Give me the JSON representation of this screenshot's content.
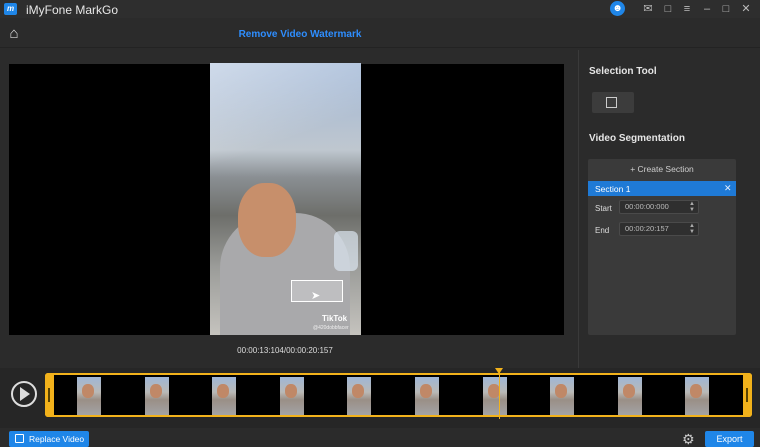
{
  "app": {
    "title": "iMyFone MarkGo",
    "logo_text": "m"
  },
  "window_controls": {
    "avatar_icon": "user-icon",
    "mail_icon": "mail-icon",
    "feedback_icon": "feedback-icon",
    "menu_icon": "menu-icon",
    "minimize_icon": "minimize-icon",
    "maximize_icon": "maximize-icon",
    "close_icon": "close-icon"
  },
  "toolbar": {
    "home_icon": "home-icon",
    "page_title": "Remove Video Watermark"
  },
  "preview": {
    "timecode": "00:00:13:104/00:00:20:157",
    "watermark_brand": "TikTok",
    "watermark_handle": "@420dobbfacer"
  },
  "panel": {
    "selection_tool_heading": "Selection Tool",
    "segmentation_heading": "Video Segmentation",
    "create_section_label": "+ Create Section",
    "section_name": "Section 1",
    "start_label": "Start",
    "start_value": "00:00:00:000",
    "end_label": "End",
    "end_value": "00:00:20:157"
  },
  "timeline": {
    "playhead_fraction": 0.647
  },
  "footer": {
    "replace_video_label": "Replace Video",
    "export_label": "Export"
  },
  "colors": {
    "accent": "#1f86e8",
    "title_blue": "#2e8eff",
    "trim_yellow": "#f2b21b"
  }
}
